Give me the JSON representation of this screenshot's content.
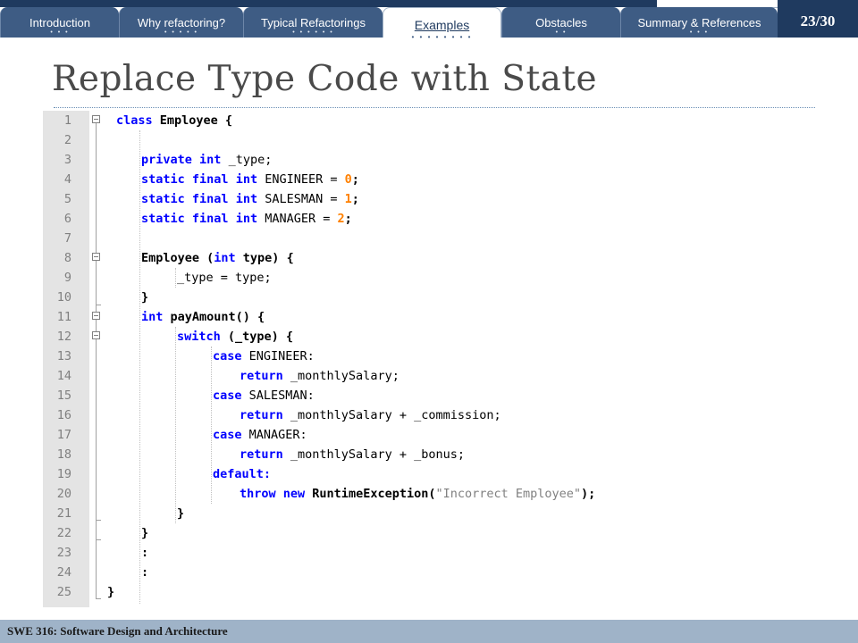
{
  "nav": {
    "tabs": [
      {
        "label": "Introduction",
        "dots": "• • •",
        "active": false
      },
      {
        "label": "Why refactoring?",
        "dots": "• • • • •",
        "active": false
      },
      {
        "label": "Typical Refactorings",
        "dots": "• • • • • •",
        "active": false
      },
      {
        "label": "Examples",
        "dots": "• • • • • • • •",
        "active": true
      },
      {
        "label": "Obstacles",
        "dots": "• •",
        "active": false
      },
      {
        "label": "Summary & References",
        "dots": "• • •",
        "active": false
      }
    ],
    "page_number": "23/30"
  },
  "slide": {
    "title": "Replace Type Code with State"
  },
  "code": {
    "lines": [
      {
        "n": "1"
      },
      {
        "n": "2"
      },
      {
        "n": "3"
      },
      {
        "n": "4"
      },
      {
        "n": "5"
      },
      {
        "n": "6"
      },
      {
        "n": "7"
      },
      {
        "n": "8"
      },
      {
        "n": "9"
      },
      {
        "n": "10"
      },
      {
        "n": "11"
      },
      {
        "n": "12"
      },
      {
        "n": "13"
      },
      {
        "n": "14"
      },
      {
        "n": "15"
      },
      {
        "n": "16"
      },
      {
        "n": "17"
      },
      {
        "n": "18"
      },
      {
        "n": "19"
      },
      {
        "n": "20"
      },
      {
        "n": "21"
      },
      {
        "n": "22"
      },
      {
        "n": "23"
      },
      {
        "n": "24"
      },
      {
        "n": "25"
      }
    ],
    "tokens": {
      "class": "class",
      "class_name": " Employee {",
      "private": "private",
      "int": "int",
      "type_field": " _type;",
      "static": "static",
      "final": "final",
      "engineer_decl": " ENGINEER = ",
      "salesman_decl": " SALESMAN = ",
      "manager_decl": " MANAGER = ",
      "zero": "0",
      "one": "1",
      "two": "2",
      "semi": ";",
      "ctor": "Employee (",
      "type_param": " type) {",
      "assign": "_type = type;",
      "close": "}",
      "pay": " payAmount() {",
      "switch": "switch",
      "switch_rest": " (_type) {",
      "case": "case",
      "case_engineer": " ENGINEER:",
      "case_salesman": " SALESMAN:",
      "case_manager": " MANAGER:",
      "return": "return",
      "ret1": " _monthlySalary;",
      "ret2": " _monthlySalary + _commission;",
      "ret3": " _monthlySalary + _bonus;",
      "default": "default:",
      "throw": "throw",
      "new": "new",
      "exc": " RuntimeException(",
      "exc_msg": "\"Incorrect Employee\"",
      "exc_end": ");",
      "colon": ":"
    }
  },
  "footer": {
    "course": "SWE 316: Software Design and Architecture"
  }
}
